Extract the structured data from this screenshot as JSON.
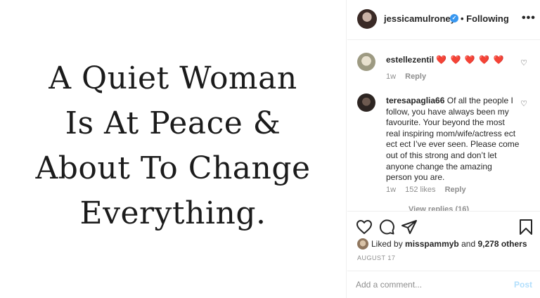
{
  "post_image": {
    "quote_lines": [
      "A Quiet Woman",
      "Is At Peace &",
      "About To Change",
      "Everything."
    ]
  },
  "header": {
    "username": "jessicamulroney",
    "following_label": "• Following",
    "more_label": "•••"
  },
  "comments": [
    {
      "username": "estellezentil",
      "text": "❤️ ❤️ ❤️ ❤️ ❤️",
      "age": "1w",
      "reply_label": "Reply"
    },
    {
      "username": "teresapaglia66",
      "text": "Of all the people I follow, you have always been my favourite. Your beyond the most real inspiring mom/wife/actress ect ect ect I’ve ever seen. Please come out of this strong and don’t let anyone change the amazing person you are.",
      "age": "1w",
      "likes": "152 likes",
      "reply_label": "Reply"
    }
  ],
  "view_replies": "View replies (16)",
  "likes": {
    "prefix": "Liked by",
    "user": "misspammyb",
    "conjunction": "and",
    "others": "9,278 others"
  },
  "date": "AUGUST 17",
  "add_comment": {
    "placeholder": "Add a comment...",
    "post_label": "Post"
  },
  "colors": {
    "verified": "#3897f0",
    "heart": "#ed4956",
    "post_button_disabled": "#b2dffc",
    "muted_text": "#8e8e8e"
  },
  "icons": [
    "verified-badge-icon",
    "more-options-icon",
    "heart-icon",
    "comment-icon",
    "share-icon",
    "bookmark-icon"
  ]
}
